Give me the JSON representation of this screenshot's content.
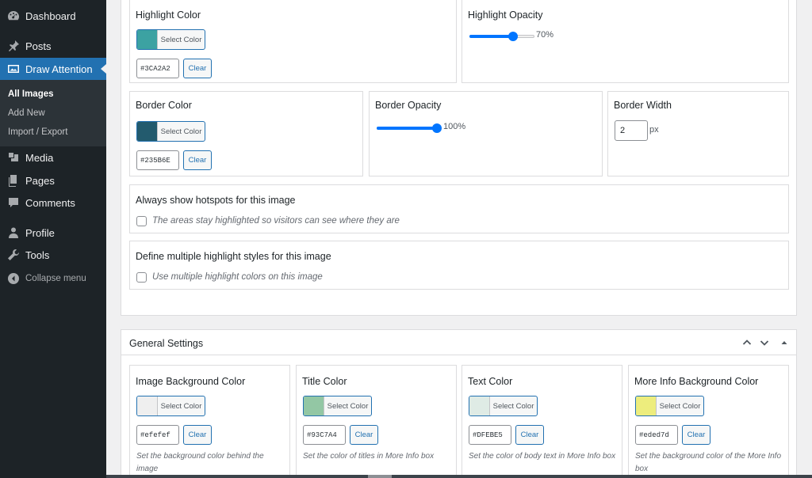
{
  "sidebar": {
    "items": [
      {
        "label": "Dashboard",
        "icon": "dashboard-icon"
      },
      {
        "label": "Posts",
        "icon": "pin-icon"
      },
      {
        "label": "Draw Attention",
        "icon": "image-icon"
      },
      {
        "label": "Media",
        "icon": "media-icon"
      },
      {
        "label": "Pages",
        "icon": "pages-icon"
      },
      {
        "label": "Comments",
        "icon": "comment-icon"
      },
      {
        "label": "Profile",
        "icon": "user-icon"
      },
      {
        "label": "Tools",
        "icon": "wrench-icon"
      }
    ],
    "submenu": [
      "All Images",
      "Add New",
      "Import / Export"
    ],
    "collapse_label": "Collapse menu"
  },
  "highlight": {
    "color_title": "Highlight Color",
    "color_hex": "#3CA2A2",
    "swatch": "#3ca2a2",
    "opacity_title": "Highlight Opacity",
    "opacity_value": "70%",
    "opacity_level": 0.7
  },
  "border": {
    "color_title": "Border Color",
    "color_hex": "#235B6E",
    "swatch": "#235b6e",
    "opacity_title": "Border Opacity",
    "opacity_value": "100%",
    "opacity_level": 1.0,
    "width_title": "Border Width",
    "width_value": "2",
    "width_unit": "px"
  },
  "always_show": {
    "title": "Always show hotspots for this image",
    "checkbox_label": "The areas stay highlighted so visitors can see where they are"
  },
  "multiple_styles": {
    "title": "Define multiple highlight styles for this image",
    "checkbox_label": "Use multiple highlight colors on this image"
  },
  "general": {
    "title": "General Settings",
    "fields": [
      {
        "title": "Image Background Color",
        "hex": "#efefef",
        "swatch": "#efefef",
        "desc": "Set the background color behind the image"
      },
      {
        "title": "Title Color",
        "hex": "#93C7A4",
        "swatch": "#93c7a4",
        "desc": "Set the color of titles in More Info box"
      },
      {
        "title": "Text Color",
        "hex": "#DFEBE5",
        "swatch": "#dfebe5",
        "desc": "Set the color of body text in More Info box"
      },
      {
        "title": "More Info Background Color",
        "hex": "#eded7d",
        "swatch": "#eded7d",
        "desc": "Set the background color of the More Info box"
      }
    ]
  },
  "buttons": {
    "select_color": "Select Color",
    "clear": "Clear"
  },
  "colors": {
    "sidebar_bg": "#1d2327",
    "active": "#2271b1",
    "slider": "#0075ff"
  }
}
